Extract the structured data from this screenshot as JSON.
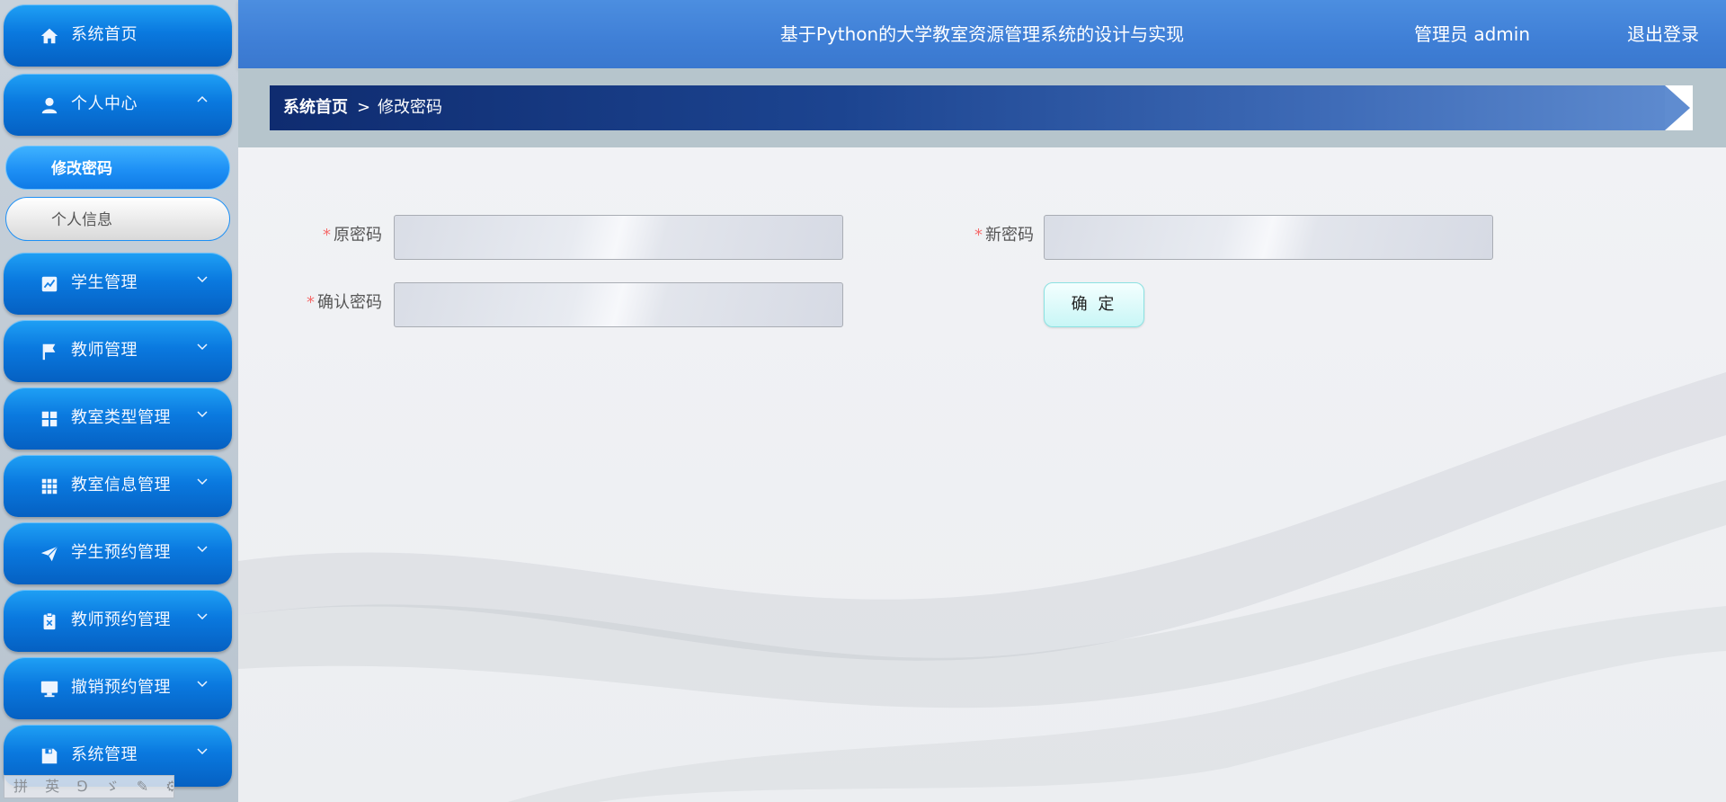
{
  "header": {
    "title": "基于Python的大学教室资源管理系统的设计与实现",
    "user_label": "管理员 admin",
    "logout_label": "退出登录"
  },
  "sidebar": {
    "items": [
      {
        "label": "系统首页",
        "icon": "home-icon"
      },
      {
        "label": "个人中心",
        "icon": "user-icon",
        "expanded": true
      },
      {
        "label": "学生管理",
        "icon": "chart-icon"
      },
      {
        "label": "教师管理",
        "icon": "flag-icon"
      },
      {
        "label": "教室类型管理",
        "icon": "grid-icon"
      },
      {
        "label": "教室信息管理",
        "icon": "apps-icon"
      },
      {
        "label": "学生预约管理",
        "icon": "send-icon"
      },
      {
        "label": "教师预约管理",
        "icon": "clipboard-icon"
      },
      {
        "label": "撤销预约管理",
        "icon": "monitor-icon"
      },
      {
        "label": "系统管理",
        "icon": "save-icon"
      }
    ],
    "sub_items": [
      {
        "label": "修改密码",
        "active": true
      },
      {
        "label": "个人信息",
        "active": false
      }
    ],
    "bottom_toolbar": "拼 英 ⅁ ゞ ✎ ⚙ ⊞"
  },
  "breadcrumb": {
    "home": "系统首页",
    "separator": ">",
    "current": "修改密码"
  },
  "form": {
    "old_password": {
      "label": "原密码",
      "required_mark": "*",
      "value": "",
      "placeholder": ""
    },
    "new_password": {
      "label": "新密码",
      "required_mark": "*",
      "value": "",
      "placeholder": ""
    },
    "confirm_password": {
      "label": "确认密码",
      "required_mark": "*",
      "value": "",
      "placeholder": ""
    },
    "submit_label": "确 定"
  },
  "colors": {
    "accent": "#0a79df",
    "header": "#4c8ee0",
    "breadcrumb_dark": "#0f2c70",
    "required": "#f56c6c"
  }
}
